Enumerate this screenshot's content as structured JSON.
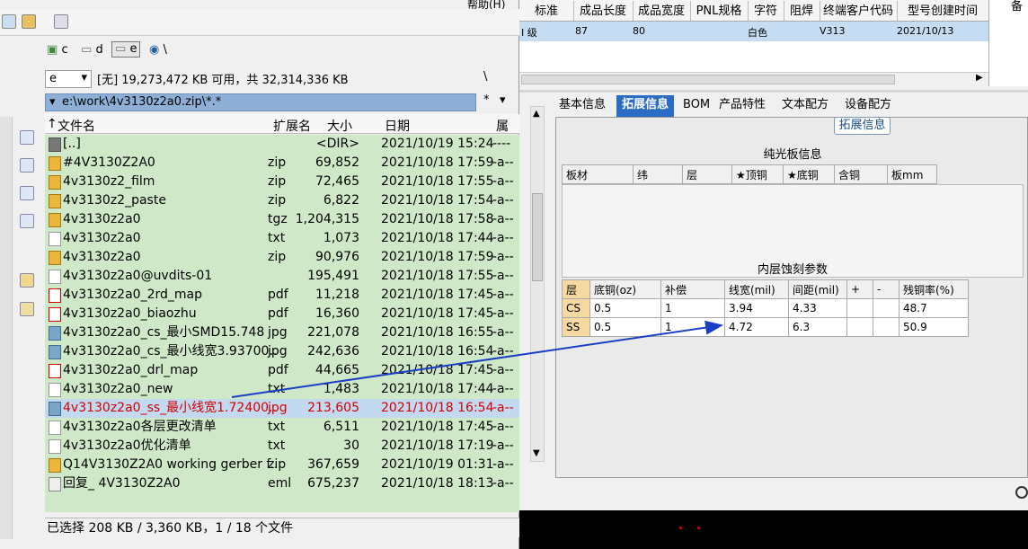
{
  "file_manager": {
    "toolbar_top_text": "帮助(H)",
    "drives": [
      "c",
      "d",
      "e",
      "\\"
    ],
    "current_drive": "e",
    "free_info": "[无]  19,273,472 KB 可用，共 32,314,336 KB",
    "path": "e:\\work\\4v3130z2a0.zip\\*.*",
    "path_right_symbol": "\\",
    "path_right_symbol2": "*",
    "columns": {
      "name": "文件名",
      "ext": "扩展名",
      "size": "大小",
      "date": "日期",
      "attr": "属性"
    },
    "files": [
      {
        "name": "[..]",
        "ext": "",
        "size": "<DIR>",
        "date": "2021/10/19 15:24",
        "attr": "----",
        "icon": "up"
      },
      {
        "name": "#4V3130Z2A0",
        "ext": "zip",
        "size": "69,852",
        "date": "2021/10/18 17:59",
        "attr": "-a--",
        "icon": "zip"
      },
      {
        "name": "4v3130z2_film",
        "ext": "zip",
        "size": "72,465",
        "date": "2021/10/18 17:55",
        "attr": "-a--",
        "icon": "zip"
      },
      {
        "name": "4v3130z2_paste",
        "ext": "zip",
        "size": "6,822",
        "date": "2021/10/18 17:54",
        "attr": "-a--",
        "icon": "zip"
      },
      {
        "name": "4v3130z2a0",
        "ext": "tgz",
        "size": "1,204,315",
        "date": "2021/10/18 17:58",
        "attr": "-a--",
        "icon": "zip"
      },
      {
        "name": "4v3130z2a0",
        "ext": "txt",
        "size": "1,073",
        "date": "2021/10/18 17:44",
        "attr": "-a--",
        "icon": "txt"
      },
      {
        "name": "4v3130z2a0",
        "ext": "zip",
        "size": "90,976",
        "date": "2021/10/18 17:59",
        "attr": "-a--",
        "icon": "zip"
      },
      {
        "name": "4v3130z2a0@uvdits-01",
        "ext": "",
        "size": "195,491",
        "date": "2021/10/18 17:55",
        "attr": "-a--",
        "icon": "txt"
      },
      {
        "name": "4v3130z2a0_2rd_map",
        "ext": "pdf",
        "size": "11,218",
        "date": "2021/10/18 17:45",
        "attr": "-a--",
        "icon": "pdf"
      },
      {
        "name": "4v3130z2a0_biaozhu",
        "ext": "pdf",
        "size": "16,360",
        "date": "2021/10/18 17:45",
        "attr": "-a--",
        "icon": "pdf"
      },
      {
        "name": "4v3130z2a0_cs_最小SMD15.748",
        "ext": "jpg",
        "size": "221,078",
        "date": "2021/10/18 16:55",
        "attr": "-a--",
        "icon": "jpg"
      },
      {
        "name": "4v3130z2a0_cs_最小线宽3.93700..",
        "ext": "jpg",
        "size": "242,636",
        "date": "2021/10/18 16:54",
        "attr": "-a--",
        "icon": "jpg"
      },
      {
        "name": "4v3130z2a0_drl_map",
        "ext": "pdf",
        "size": "44,665",
        "date": "2021/10/18 17:45",
        "attr": "-a--",
        "icon": "pdf"
      },
      {
        "name": "4v3130z2a0_new",
        "ext": "txt",
        "size": "1,483",
        "date": "2021/10/18 17:44",
        "attr": "-a--",
        "icon": "txt"
      },
      {
        "name": "4v3130z2a0_ss_最小线宽1.72400..",
        "ext": "jpg",
        "size": "213,605",
        "date": "2021/10/18 16:54",
        "attr": "-a--",
        "icon": "jpg",
        "selected": true
      },
      {
        "name": "4v3130z2a0各层更改清单",
        "ext": "txt",
        "size": "6,511",
        "date": "2021/10/18 17:45",
        "attr": "-a--",
        "icon": "txt"
      },
      {
        "name": "4v3130z2a0优化清单",
        "ext": "txt",
        "size": "30",
        "date": "2021/10/18 17:19",
        "attr": "-a--",
        "icon": "txt"
      },
      {
        "name": "Q14V3130Z2A0 working gerber f..",
        "ext": "zip",
        "size": "367,659",
        "date": "2021/10/19 01:31",
        "attr": "-a--",
        "icon": "zip"
      },
      {
        "name": "回复_ 4V3130Z2A0",
        "ext": "eml",
        "size": "675,237",
        "date": "2021/10/18 18:13",
        "attr": "-a--",
        "icon": "eml"
      }
    ],
    "status": "已选择 208 KB / 3,360 KB，1 / 18 个文件"
  },
  "right_app": {
    "grid_headers": [
      "标准",
      "成品长度",
      "成品宽度",
      "PNL规格",
      "字符",
      "阻焊",
      "终端客户代码",
      "型号创建时间"
    ],
    "grid_row": [
      "I 级",
      "87",
      "80",
      "",
      "白色",
      "",
      "V313",
      "2021/10/13"
    ],
    "right_cut_label": "备",
    "tabs": [
      "基本信息",
      "拓展信息",
      "BOM",
      "产品特性",
      "文本配方",
      "设备配方"
    ],
    "active_tab": "拓展信息",
    "panel_title": "拓展信息",
    "bare_board_title": "纯光板信息",
    "bare_board_headers": [
      "板材",
      "纬",
      "层",
      "★顶铜",
      "★底铜",
      "含铜",
      "板mm"
    ],
    "etch_title": "内层蚀刻参数",
    "etch_headers": [
      "层",
      "底铜(oz)",
      "补偿",
      "线宽(mil)",
      "间距(mil)",
      "+",
      "-",
      "残铜率(%)"
    ],
    "etch_rows": [
      [
        "CS",
        "0.5",
        "1",
        "3.94",
        "4.33",
        "",
        "",
        "48.7"
      ],
      [
        "SS",
        "0.5",
        "1",
        "4.72",
        "6.3",
        "",
        "",
        "50.9"
      ]
    ]
  },
  "colors": {
    "list_bg": "#cfe8c8",
    "selection": "#c2d9f0",
    "selected_text": "#d40000",
    "tab_active": "#2b6cc4",
    "arrow": "#1a3fc4"
  }
}
